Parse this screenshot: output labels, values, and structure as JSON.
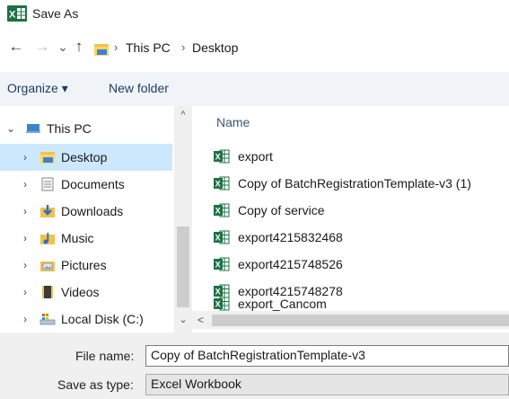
{
  "window": {
    "title": "Save As"
  },
  "nav": {
    "back": "←",
    "forward": "→",
    "recent": "⌄",
    "up": "↑",
    "path": [
      "This PC",
      "Desktop"
    ]
  },
  "toolbar": {
    "organize": "Organize ▾",
    "new_folder": "New folder"
  },
  "nav_pane": {
    "this_pc": "This PC",
    "items": [
      "Desktop",
      "Documents",
      "Downloads",
      "Music",
      "Pictures",
      "Videos",
      "Local Disk (C:)"
    ],
    "selected": "Desktop"
  },
  "file_list": {
    "column": "Name",
    "files": [
      "export",
      "Copy of BatchRegistrationTemplate-v3 (1)",
      "Copy of service",
      "export4215832468",
      "export4215748526",
      "export4215748278",
      "export_Cancom"
    ]
  },
  "form": {
    "file_name_label": "File name:",
    "file_name_value": "Copy of BatchRegistrationTemplate-v3",
    "type_label": "Save as type:",
    "type_value": "Excel Workbook"
  },
  "colors": {
    "selected_bg": "#cce8ff",
    "excel_green": "#1e7145",
    "folder_yellow": "#f3c24a"
  }
}
